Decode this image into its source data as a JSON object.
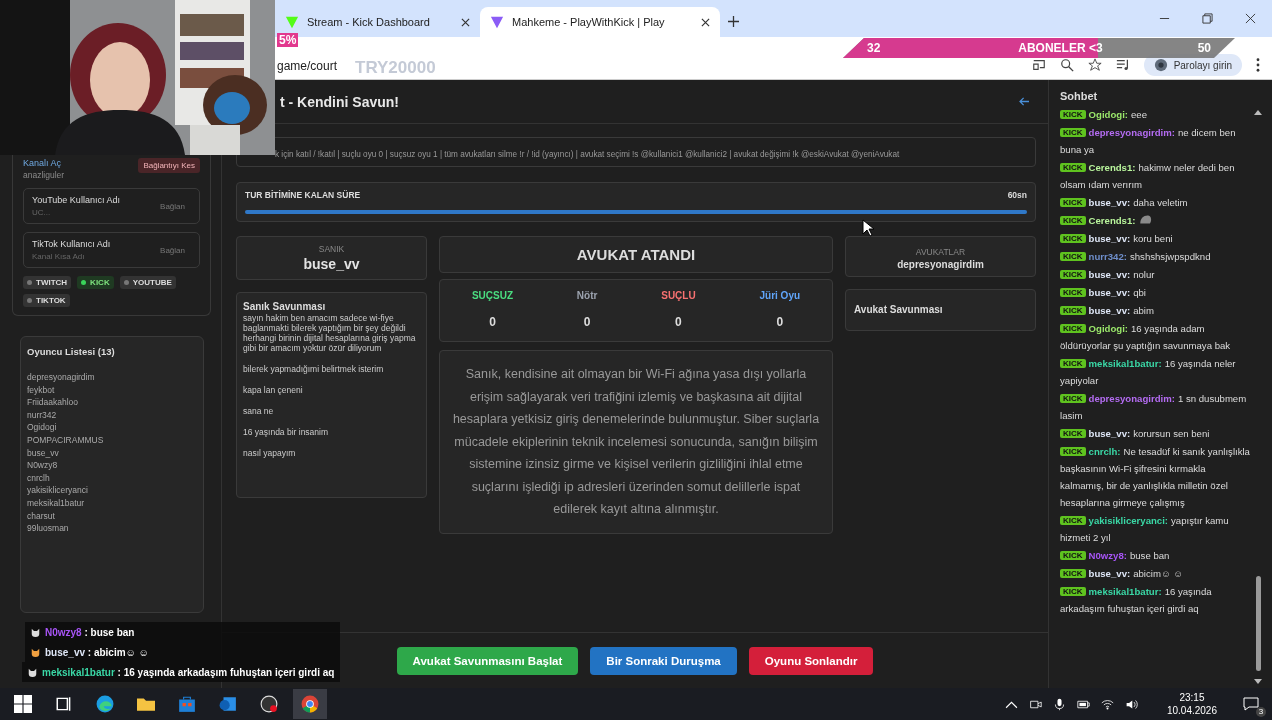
{
  "browser": {
    "tabs": [
      {
        "title": "Stream - Kick Dashboard",
        "selected": false
      },
      {
        "title": "Mahkeme - PlayWithKick | Play",
        "selected": true
      }
    ],
    "url": "game/court",
    "profile": "Parolayı girin"
  },
  "stream_overlay": {
    "percent": "5%",
    "code": "TRY20000",
    "goal": {
      "current": "32",
      "label": "ABONELER <3",
      "target": "50",
      "level": 0.65
    }
  },
  "sidebar": {
    "kick": {
      "link": "Kanalı Aç",
      "value": "anazliguler",
      "button": "Bağlantıyı Kes"
    },
    "accounts": [
      {
        "label": "YouTube Kullanıcı Adı",
        "placeholder": "UC...",
        "button": "Bağlan"
      },
      {
        "label": "TikTok Kullanıcı Adı",
        "placeholder": "Kanal Kısa Adı",
        "button": "Bağlan"
      }
    ],
    "platforms": [
      {
        "label": "TWITCH",
        "on": false
      },
      {
        "label": "KICK",
        "on": true
      },
      {
        "label": "YOUTUBE",
        "on": false
      },
      {
        "label": "TIKTOK",
        "on": false
      }
    ],
    "player_list": {
      "title": "Oyuncu Listesi (13)",
      "players": [
        "depresyonagirdim",
        "feykbot",
        "Friidaakahloo",
        "nurr342",
        "Ogidogi",
        "POMPACIRAMMUS",
        "buse_vv",
        "N0wzy8",
        "cnrclh",
        "yakisikliceryanci",
        "meksikal1batur",
        "charsut",
        "99luosman"
      ]
    }
  },
  "main": {
    "title": "t - Kendini Savun!",
    "commands": "k için katıl / !katıl | suçlu oyu 0 | suçsuz oyu 1 | tüm avukatları silme !r / !id (yayıncı) | avukat seçimi !s @kullanici1 @kullanici2 | avukat değişimi !k @eskiAvukat @yeniAvukat",
    "timer": {
      "label": "TUR BİTİMİNE KALAN SÜRE",
      "reading": "60sn",
      "level": 1
    },
    "defendant": {
      "label": "SANIK",
      "name": "buse_vv"
    },
    "defense": {
      "title": "Sanık Savunması",
      "lines": [
        "sayın hakim ben amacım sadece wi-fiye baglanmakti bilerek yaptığım bir şey değildi herhangi birinin dijital hesaplarına giriş yapma gibi bir amacım yoktur özür diliyorum",
        "bilerek yapmadığımi belirtmek isterim",
        "kapa lan çeneni",
        "sana ne",
        "16 yaşında bir insanim",
        "nasıl yapayım"
      ]
    },
    "status": "AVUKAT ATANDI",
    "votes": [
      {
        "label": "SUÇSUZ",
        "count": "0",
        "color": "#4ade80"
      },
      {
        "label": "Nötr",
        "count": "0",
        "color": "#9ca3af"
      },
      {
        "label": "SUÇLU",
        "count": "0",
        "color": "#f87171"
      },
      {
        "label": "Jüri Oyu",
        "count": "0",
        "color": "#60a5fa"
      }
    ],
    "accusation": "Sanık, kendisine ait olmayan bir Wi-Fi ağına yasa dışı yollarla erişim sağlayarak veri trafiğini izlemiş ve başkasına ait dijital hesaplara yetkisiz giriş denemelerinde bulunmuştur. Siber suçlarla mücadele ekiplerinin teknik incelemesi sonucunda, sanığın bilişim sistemine izinsiz girme ve kişisel verilerin gizliliğini ihlal etme suçlarını işlediği ip adresleri üzerinden somut delillerle ispat edilerek kayıt altına alınmıştır.",
    "lawyers": {
      "label": "AVUKATLAR",
      "name": "depresyonagirdim"
    },
    "lawyer_defense": {
      "title": "Avukat Savunması"
    },
    "buttons": [
      {
        "label": "Avukat Savunmasını Başlat",
        "color": "#2ea84a"
      },
      {
        "label": "Bir Sonraki Duruşma",
        "color": "#2273c3"
      },
      {
        "label": "Oyunu Sonlandır",
        "color": "#d41f3a"
      }
    ]
  },
  "chat": {
    "title": "Sohbet",
    "messages": [
      {
        "kind": "text",
        "badge": "KICK",
        "user": "Ogidogi:",
        "color": "#9be86b",
        "text": "eee"
      },
      {
        "kind": "text",
        "badge": "KICK",
        "user": "depresyonagirdim:",
        "color": "#b46cf2",
        "text": "ne dicem ben buna ya"
      },
      {
        "kind": "text",
        "badge": "KICK",
        "user": "Cerends1:",
        "color": "#b9f59c",
        "text": "hakimw neler dedi ben olsam ıdam verırım"
      },
      {
        "kind": "text",
        "badge": "KICK",
        "user": "buse_vv:",
        "color": "#dfe7f7",
        "text": "daha veletim"
      },
      {
        "kind": "emote",
        "badge": "KICK",
        "user": "Cerends1:",
        "color": "#b9f59c"
      },
      {
        "kind": "text",
        "badge": "KICK",
        "user": "buse_vv:",
        "color": "#dfe7f7",
        "text": "koru beni"
      },
      {
        "kind": "text",
        "badge": "KICK",
        "user": "nurr342:",
        "color": "#6f8fcc",
        "text": "shshshsjwpspdknd"
      },
      {
        "kind": "text",
        "badge": "KICK",
        "user": "buse_vv:",
        "color": "#dfe7f7",
        "text": "nolur"
      },
      {
        "kind": "text",
        "badge": "KICK",
        "user": "buse_vv:",
        "color": "#dfe7f7",
        "text": "qbi"
      },
      {
        "kind": "text",
        "badge": "KICK",
        "user": "buse_vv:",
        "color": "#dfe7f7",
        "text": "abim"
      },
      {
        "kind": "text",
        "badge": "KICK",
        "user": "Ogidogi:",
        "color": "#9be86b",
        "text": "16 yaşında adam öldürüyorlar şu yaptığın savunmaya bak"
      },
      {
        "kind": "text",
        "badge": "KICK",
        "user": "meksikal1batur:",
        "color": "#3ad8a6",
        "text": "16 yaşında neler yapiyolar"
      },
      {
        "kind": "text",
        "badge": "KICK",
        "user": "depresyonagirdim:",
        "color": "#b46cf2",
        "text": "1 sn dusubmem lasim"
      },
      {
        "kind": "text",
        "badge": "KICK",
        "user": "buse_vv:",
        "color": "#dfe7f7",
        "text": "korursun sen beni"
      },
      {
        "kind": "text",
        "badge": "KICK",
        "user": "cnrclh:",
        "color": "#3ad8a6",
        "text": "Ne tesadüf ki sanık yanlışlıkla başkasının Wi-Fi şifresini kırmakla kalmamış, bir de yanlışlıkla milletin özel hesaplarına girmeye çalışmış"
      },
      {
        "kind": "text",
        "badge": "KICK",
        "user": "yakisikliceryanci:",
        "color": "#3ad8a6",
        "text": "yapıştır kamu hizmeti 2 yıl"
      },
      {
        "kind": "text",
        "badge": "KICK",
        "user": "N0wzy8:",
        "color": "#a855f7",
        "text": "buse ban"
      },
      {
        "kind": "text",
        "badge": "KICK",
        "user": "buse_vv:",
        "color": "#dfe7f7",
        "text": "abicim☺ ☺"
      },
      {
        "kind": "text",
        "badge": "KICK",
        "user": "meksikal1batur:",
        "color": "#3ad8a6",
        "text": "16 yaşında arkadaşım fuhuştan içeri girdi aq"
      }
    ]
  },
  "overlay_chat": [
    {
      "user": "N0wzy8",
      "color": "#a855f7",
      "text": ": buse ban"
    },
    {
      "user": "buse_vv",
      "color": "#dfe7f7",
      "text": ": abicim☺ ☺"
    },
    {
      "user": "meksikal1batur",
      "color": "#3ad8a6",
      "text": ": 16 yaşında arkadaşım fuhuştan içeri girdi aq"
    }
  ],
  "taskbar": {
    "time": "23:15",
    "date": "10.04.2026",
    "notifications": "3"
  }
}
